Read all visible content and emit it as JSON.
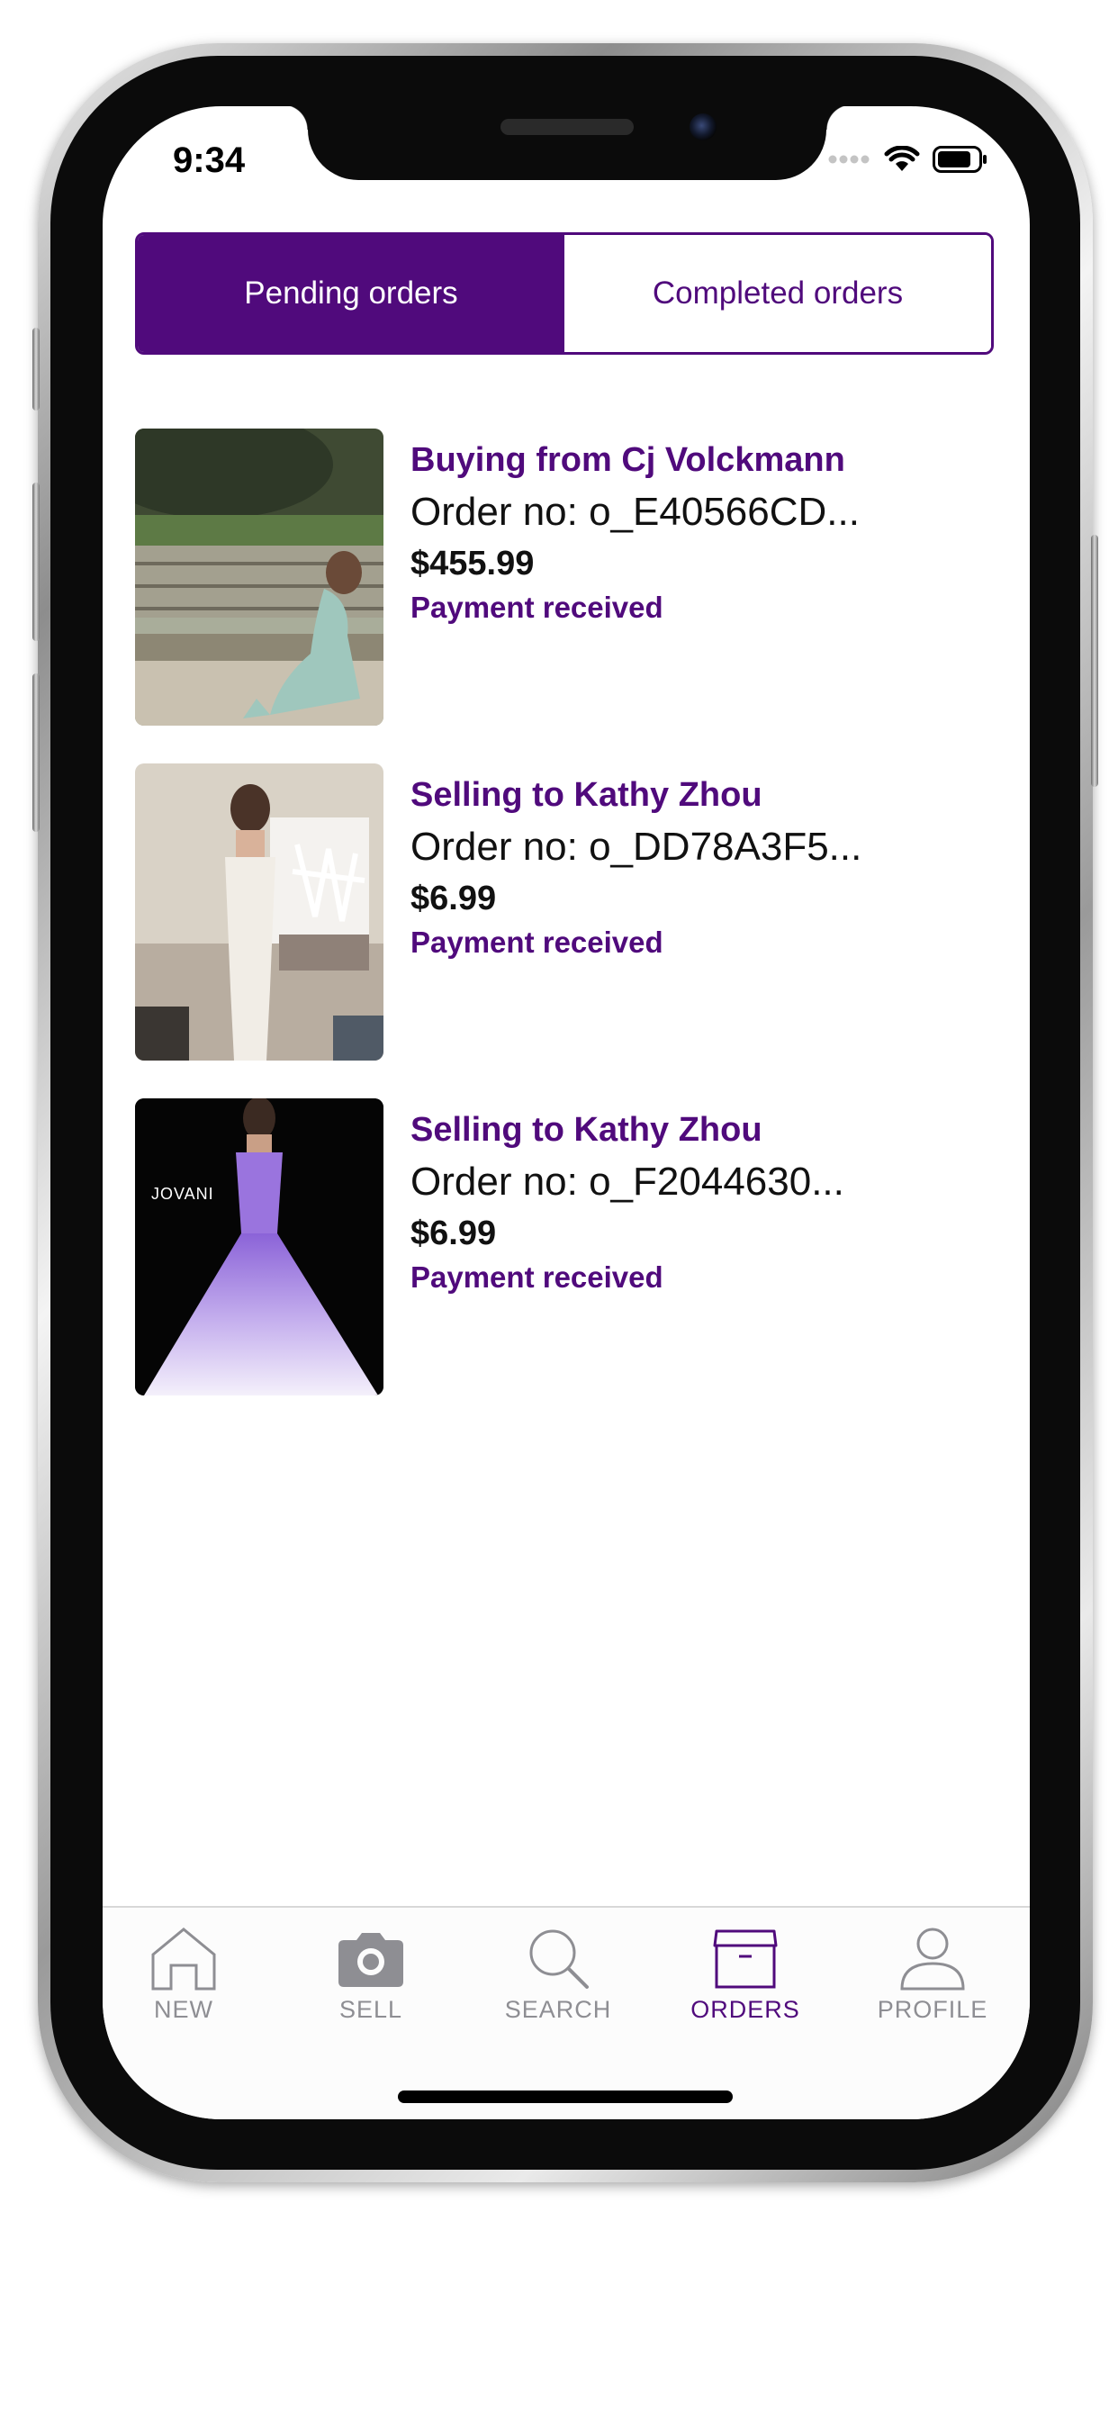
{
  "status_bar": {
    "time": "9:34"
  },
  "segmented_control": {
    "pending_label": "Pending orders",
    "completed_label": "Completed orders",
    "selected": "pending"
  },
  "orders": [
    {
      "title": "Buying from Cj Volckmann",
      "order_no": "Order no: o_E40566CD...",
      "price": "$455.99",
      "status": "Payment received"
    },
    {
      "title": "Selling to Kathy Zhou",
      "order_no": "Order no: o_DD78A3F5...",
      "price": "$6.99",
      "status": "Payment received"
    },
    {
      "title": "Selling to Kathy Zhou",
      "order_no": "Order no: o_F2044630...",
      "price": "$6.99",
      "status": "Payment received",
      "image_text": "JOVANI"
    }
  ],
  "tab_bar": {
    "items": [
      {
        "label": "NEW",
        "icon": "home-icon"
      },
      {
        "label": "SELL",
        "icon": "camera-icon"
      },
      {
        "label": "SEARCH",
        "icon": "search-icon"
      },
      {
        "label": "ORDERS",
        "icon": "box-icon"
      },
      {
        "label": "PROFILE",
        "icon": "person-icon"
      }
    ],
    "active": "ORDERS"
  },
  "colors": {
    "accent": "#500a7c",
    "inactive_tab": "#8e8e93",
    "text": "#111111"
  }
}
